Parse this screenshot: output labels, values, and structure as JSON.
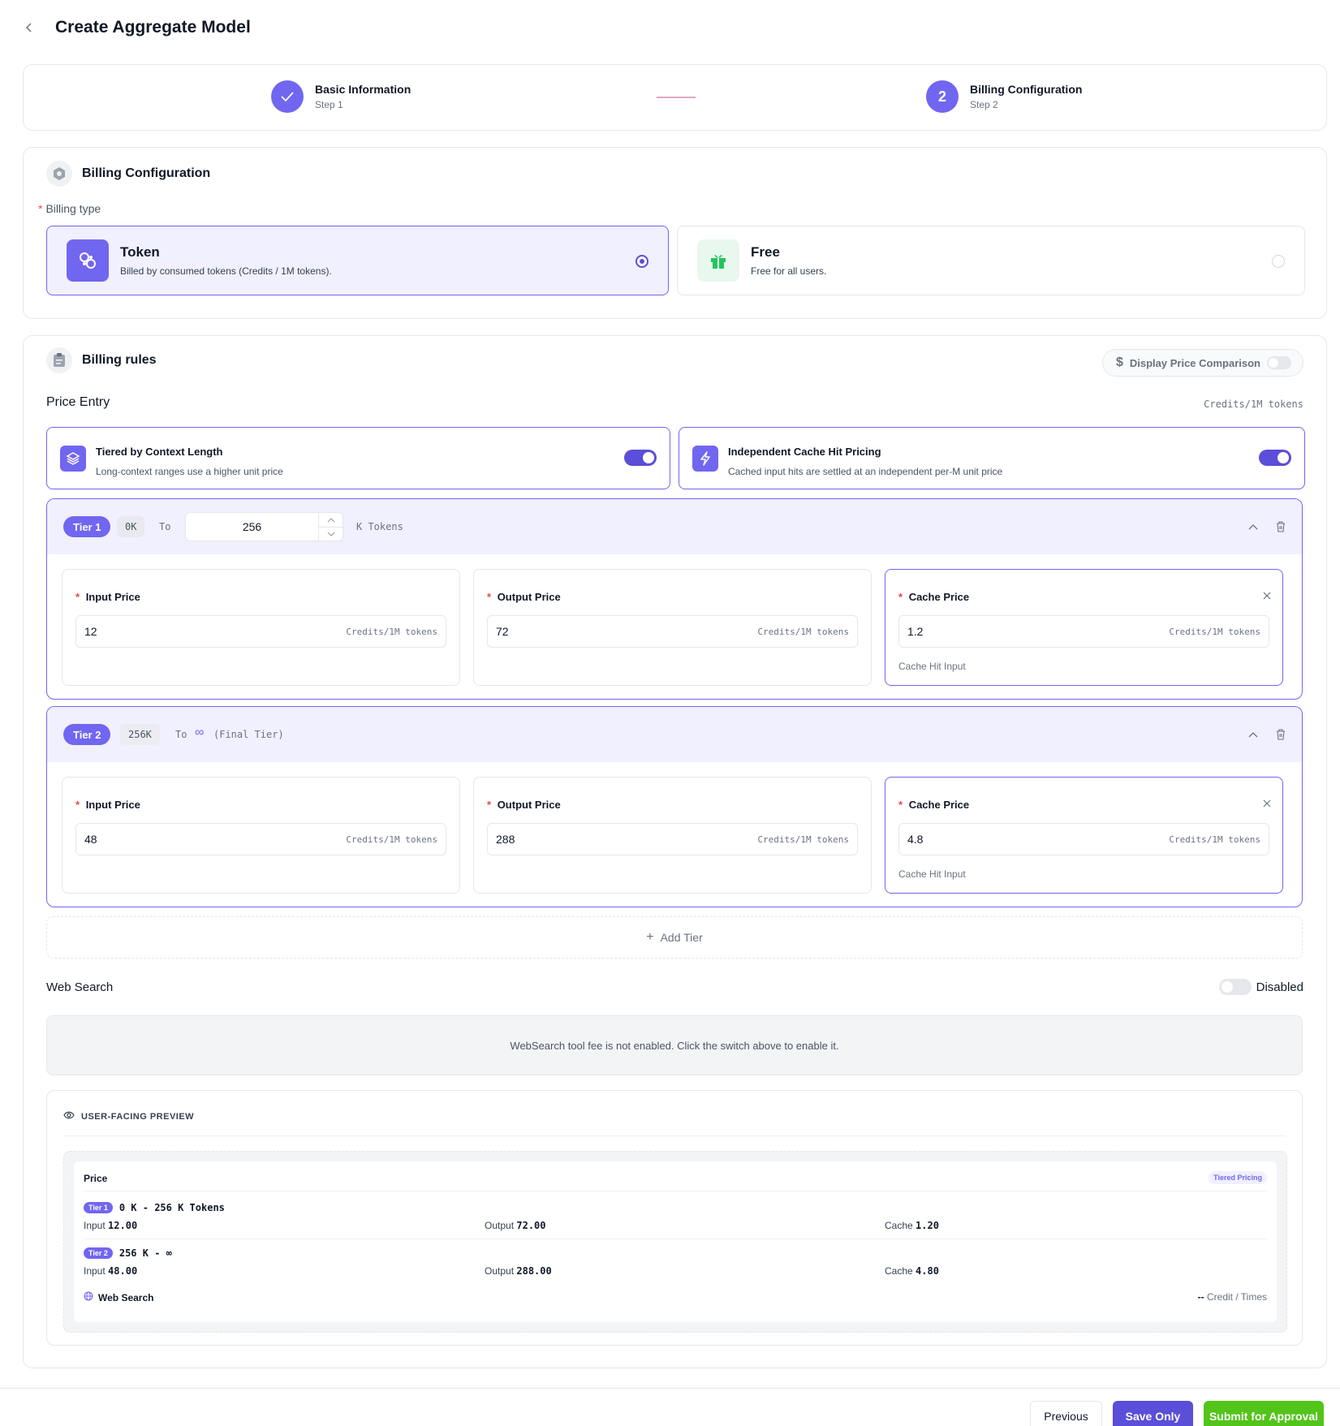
{
  "header": {
    "title": "Create Aggregate Model"
  },
  "steps": [
    {
      "title": "Basic Information",
      "sub": "Step 1",
      "state": "done"
    },
    {
      "title": "Billing Configuration",
      "sub": "Step 2",
      "number": "2",
      "state": "active"
    }
  ],
  "billing_config": {
    "title": "Billing Configuration",
    "type_label": "Billing type",
    "options": [
      {
        "title": "Token",
        "desc": "Billed by consumed tokens (Credits / 1M tokens).",
        "selected": true
      },
      {
        "title": "Free",
        "desc": "Free for all users.",
        "selected": false
      }
    ]
  },
  "billing_rules": {
    "title": "Billing rules",
    "compare_label": "Display Price Comparison",
    "price_entry_label": "Price Entry",
    "unit": "Credits/1M tokens",
    "option_cards": [
      {
        "title": "Tiered by Context Length",
        "desc": "Long-context ranges use a higher unit price",
        "enabled": true
      },
      {
        "title": "Independent Cache Hit Pricing",
        "desc": "Cached input hits are settled at an independent per-M unit price",
        "enabled": true
      }
    ],
    "tiers": [
      {
        "badge": "Tier 1",
        "from": "0K",
        "to_label": "To",
        "to_value": "256",
        "to_unit": "K Tokens",
        "input": {
          "label": "Input Price",
          "value": "12",
          "unit": "Credits/1M tokens"
        },
        "output": {
          "label": "Output Price",
          "value": "72",
          "unit": "Credits/1M tokens"
        },
        "cache": {
          "label": "Cache Price",
          "value": "1.2",
          "unit": "Credits/1M tokens",
          "hint": "Cache Hit Input"
        }
      },
      {
        "badge": "Tier 2",
        "from": "256K",
        "to_label": "To",
        "to_value": "∞",
        "to_unit": "(Final Tier)",
        "input": {
          "label": "Input Price",
          "value": "48",
          "unit": "Credits/1M tokens"
        },
        "output": {
          "label": "Output Price",
          "value": "288",
          "unit": "Credits/1M tokens"
        },
        "cache": {
          "label": "Cache Price",
          "value": "4.8",
          "unit": "Credits/1M tokens",
          "hint": "Cache Hit Input"
        }
      }
    ],
    "add_tier": "Add Tier",
    "web_search": {
      "label": "Web Search",
      "status": "Disabled",
      "info": "WebSearch tool fee is not enabled. Click the switch above to enable it."
    },
    "preview": {
      "title": "USER-FACING PREVIEW",
      "price_label": "Price",
      "tag": "Tiered Pricing",
      "rows": [
        {
          "badge": "Tier 1",
          "range": "0 K - 256 K Tokens",
          "input_label": "Input",
          "input": "12.00",
          "output_label": "Output",
          "output": "72.00",
          "cache_label": "Cache",
          "cache": "1.20"
        },
        {
          "badge": "Tier 2",
          "range": "256 K - ∞",
          "input_label": "Input",
          "input": "48.00",
          "output_label": "Output",
          "output": "288.00",
          "cache_label": "Cache",
          "cache": "4.80"
        }
      ],
      "web_label": "Web Search",
      "web_value": "--",
      "web_unit": "Credit / Times"
    }
  },
  "footer": {
    "previous": "Previous",
    "save": "Save Only",
    "submit": "Submit for Approval"
  },
  "colors": {
    "accent": "#7166f0",
    "accent_dark": "#5b4ed8",
    "success": "#52c41a",
    "free_icon": "#22c55e"
  }
}
